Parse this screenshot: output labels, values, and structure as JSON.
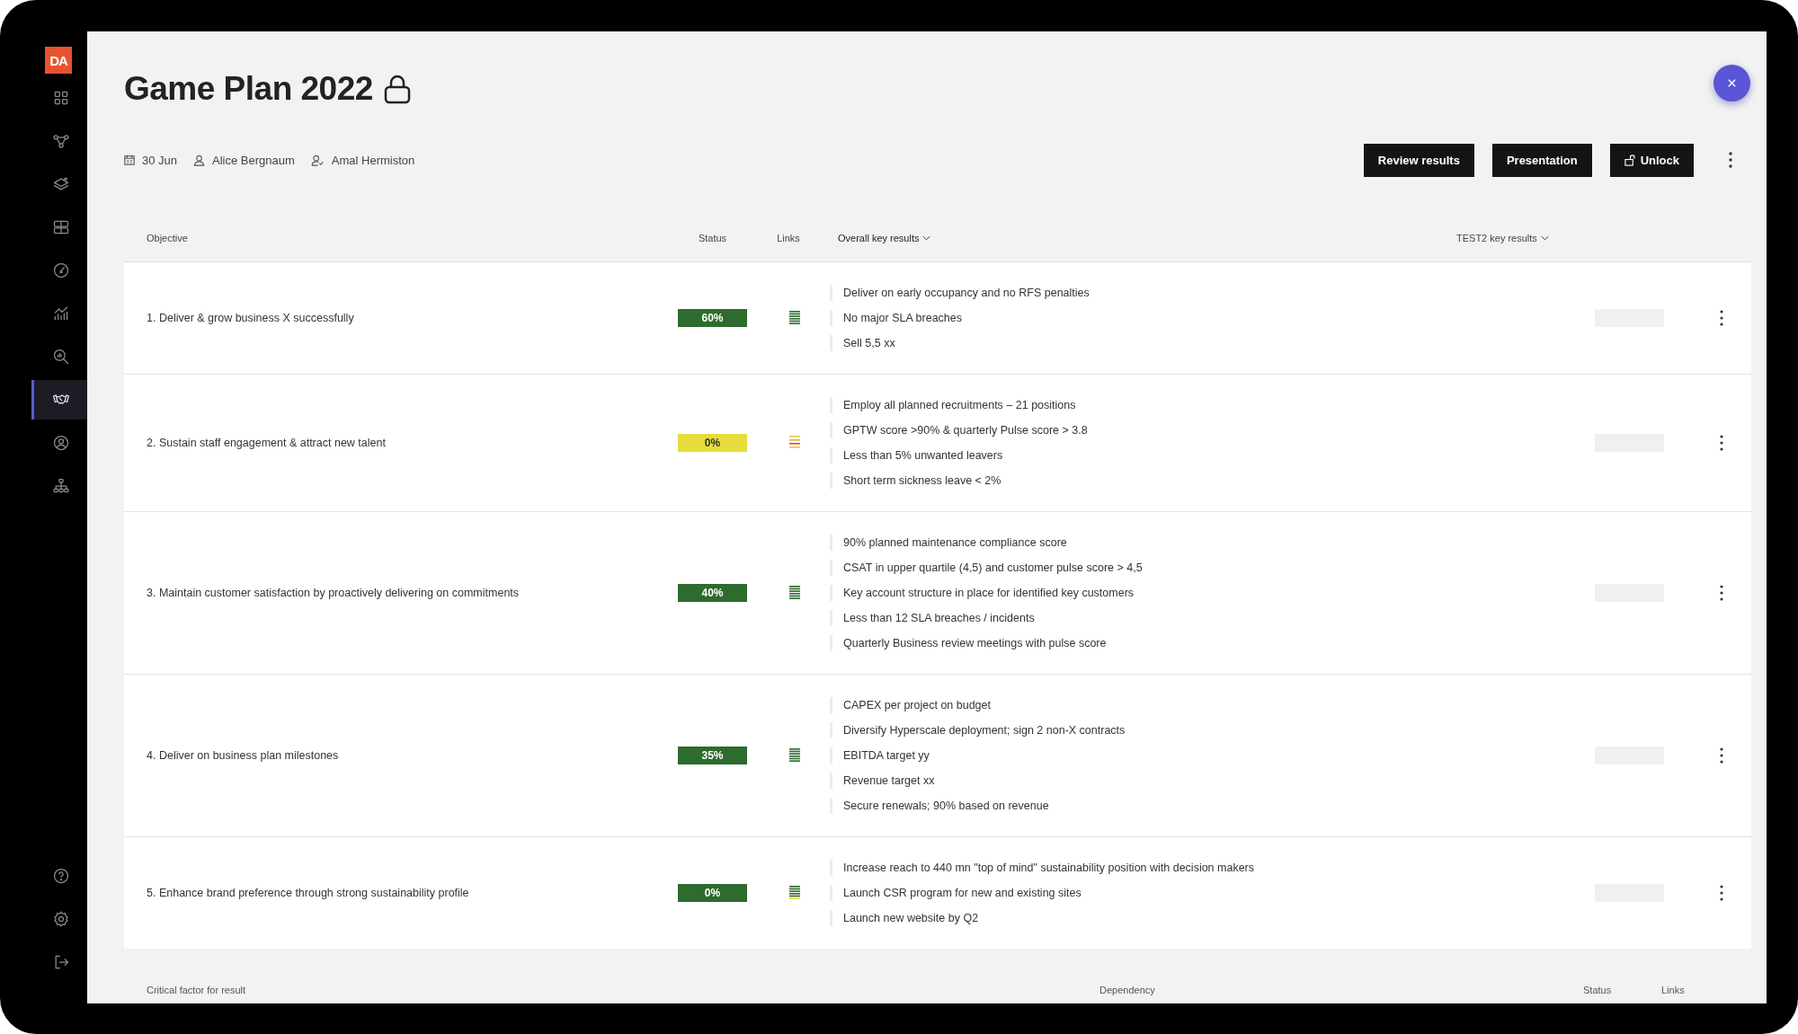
{
  "sidebar": {
    "logo": "DA",
    "items": [
      {
        "selected": false
      },
      {
        "selected": false
      },
      {
        "selected": false
      },
      {
        "selected": false
      },
      {
        "selected": false
      },
      {
        "selected": false
      },
      {
        "selected": false
      },
      {
        "selected": true
      },
      {
        "selected": false
      },
      {
        "selected": false
      }
    ],
    "bottom_items": [
      {
        "selected": false
      },
      {
        "selected": false
      },
      {
        "selected": false
      }
    ]
  },
  "title": "Game Plan 2022",
  "locked": true,
  "meta": {
    "date": "30 Jun",
    "owner": "Alice Bergnaum",
    "approver": "Amal Hermiston"
  },
  "buttons": [
    {
      "label": "Review results",
      "kind": "plain"
    },
    {
      "label": "Presentation",
      "kind": "plain"
    },
    {
      "label": "Unlock",
      "kind": "unlock"
    }
  ],
  "table": {
    "columns": [
      "Objective",
      "Status",
      "Links",
      "Overall key results",
      "TEST2 key results"
    ],
    "rows": [
      {
        "objective": "1. Deliver & grow business X successfully",
        "status": {
          "label": "60%",
          "color": "#2e6b2e"
        },
        "links": [
          {
            "color": "#2e6b2e"
          },
          {
            "color": "#2e6b2e"
          },
          {
            "color": "#2e6b2e"
          },
          {
            "color": "#2e6b2e"
          },
          {
            "color": "#2e6b2e"
          },
          {
            "color": "#2e6b2e"
          }
        ],
        "key_results": [
          "Deliver on early occupancy and no RFS penalties",
          "No major SLA breaches",
          "Sell 5,5 xx"
        ]
      },
      {
        "objective": "2. Sustain staff engagement & attract new talent",
        "status": {
          "label": "0%",
          "color": "#e6dc3c"
        },
        "links": [
          {
            "color": "#e6c83c"
          },
          {
            "color": "#e6b03c"
          },
          {
            "color": "#d9483a"
          },
          {
            "color": "#e6c83c"
          }
        ],
        "key_results": [
          "Employ all planned recruitments – 21 positions",
          "GPTW score >90% & quarterly Pulse score > 3.8",
          "Less than 5% unwanted leavers",
          "Short term sickness leave < 2%"
        ]
      },
      {
        "objective": "3. Maintain customer satisfaction by proactively delivering on commitments",
        "status": {
          "label": "40%",
          "color": "#2e6b2e"
        },
        "links": [
          {
            "color": "#2e6b2e"
          },
          {
            "color": "#2e6b2e"
          },
          {
            "color": "#2e6b2e"
          },
          {
            "color": "#2e6b2e"
          },
          {
            "color": "#2e6b2e"
          },
          {
            "color": "#2e6b2e"
          }
        ],
        "key_results": [
          "90% planned maintenance compliance score",
          "CSAT in upper quartile (4,5) and customer pulse score > 4,5",
          "Key account structure in place for identified key customers",
          "Less than 12 SLA breaches / incidents",
          "Quarterly Business review meetings with pulse score"
        ]
      },
      {
        "objective": "4. Deliver on business plan milestones",
        "status": {
          "label": "35%",
          "color": "#2e6b2e"
        },
        "links": [
          {
            "color": "#2e6b2e"
          },
          {
            "color": "#2e6b2e"
          },
          {
            "color": "#2e6b2e"
          },
          {
            "color": "#2e6b2e"
          },
          {
            "color": "#2e6b2e"
          },
          {
            "color": "#2e6b2e"
          }
        ],
        "key_results": [
          "CAPEX per project on budget",
          "Diversify Hyperscale deployment; sign 2 non-X contracts",
          "EBITDA target yy",
          "Revenue target xx",
          "Secure renewals; 90% based on revenue"
        ]
      },
      {
        "objective": "5. Enhance brand preference through strong sustainability profile",
        "status": {
          "label": "0%",
          "color": "#2e6b2e"
        },
        "links": [
          {
            "color": "#2e6b2e"
          },
          {
            "color": "#2e6b2e"
          },
          {
            "color": "#2e6b2e"
          },
          {
            "color": "#2e6b2e"
          },
          {
            "color": "#2e6b2e"
          },
          {
            "color": "#e6dc3c"
          }
        ],
        "key_results": [
          "Increase reach to 440 mn \"top of mind\" sustainability position with decision makers",
          "Launch CSR program for new and existing sites",
          "Launch new website by Q2"
        ]
      }
    ]
  },
  "second_table": {
    "columns": [
      "Critical factor for result",
      "Dependency",
      "Status",
      "Links"
    ]
  }
}
